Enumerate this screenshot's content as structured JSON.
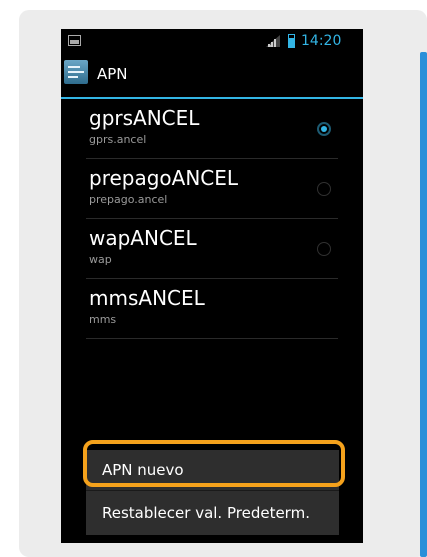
{
  "status_bar": {
    "time": "14:20",
    "icons": [
      "image-notification-icon",
      "signal-icon",
      "battery-icon"
    ]
  },
  "action_bar": {
    "title": "APN",
    "icon": "apn-settings-icon"
  },
  "apn_list": [
    {
      "name": "gprsANCEL",
      "apn": "gprs.ancel",
      "selected": true
    },
    {
      "name": "prepagoANCEL",
      "apn": "prepago.ancel",
      "selected": false
    },
    {
      "name": "wapANCEL",
      "apn": "wap",
      "selected": false
    },
    {
      "name": "mmsANCEL",
      "apn": "mms",
      "selected": null
    }
  ],
  "menu": {
    "new_apn": "APN nuevo",
    "reset_defaults": "Restablecer val. Predeterm."
  },
  "colors": {
    "accent": "#33b5e5",
    "highlight": "#f5a21c",
    "card_background": "#ececec",
    "card_accent": "#2a8fd9"
  }
}
